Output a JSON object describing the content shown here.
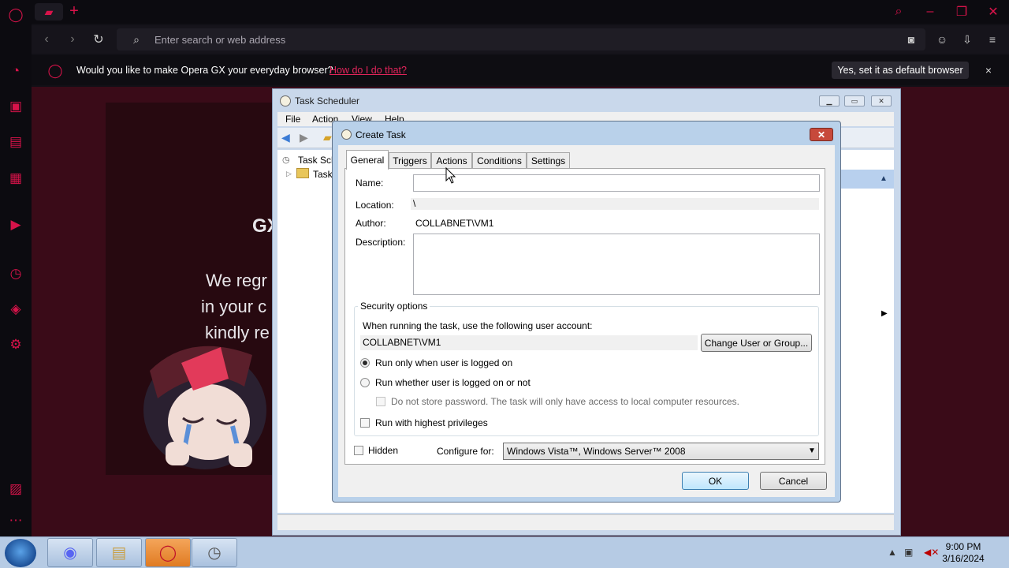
{
  "browser": {
    "search_placeholder": "Enter search or web address",
    "infobar": {
      "message": "Would you like to make Opera GX your everyday browser?",
      "link": "How do I do that?",
      "button": "Yes, set it as default browser",
      "close": "×"
    },
    "page_text": {
      "line0": "GX",
      "line1": "We regr",
      "line2": "in your c",
      "line3": "kindly re"
    }
  },
  "task_scheduler": {
    "title": "Task Scheduler",
    "menu": [
      "File",
      "Action",
      "View",
      "Help"
    ],
    "tree": [
      "Task Sch",
      "Task"
    ]
  },
  "create_task": {
    "title": "Create Task",
    "close": "✕",
    "tabs": [
      "General",
      "Triggers",
      "Actions",
      "Conditions",
      "Settings"
    ],
    "name_label": "Name:",
    "name_value": "",
    "location_label": "Location:",
    "location_value": "\\",
    "author_label": "Author:",
    "author_value": "COLLABNET\\VM1",
    "description_label": "Description:",
    "description_value": "",
    "security": {
      "title": "Security options",
      "account_prompt": "When running the task, use the following user account:",
      "account_value": "COLLABNET\\VM1",
      "change_button": "Change User or Group...",
      "radio_logged_on": "Run only when user is logged on",
      "radio_whether": "Run whether user is logged on or not",
      "no_store_password": "Do not store password.  The task will only have access to local computer resources.",
      "highest_privileges": "Run with highest privileges",
      "selected_radio": "Run only when user is logged on"
    },
    "hidden_label": "Hidden",
    "configure_label": "Configure for:",
    "configure_value": "Windows Vista™, Windows Server™ 2008",
    "ok": "OK",
    "cancel": "Cancel"
  },
  "taskbar": {
    "time": "9:00 PM",
    "date": "3/16/2024"
  },
  "colors": {
    "opera_accent": "#d8134a",
    "dialog_frame": "#b9d1ea"
  }
}
